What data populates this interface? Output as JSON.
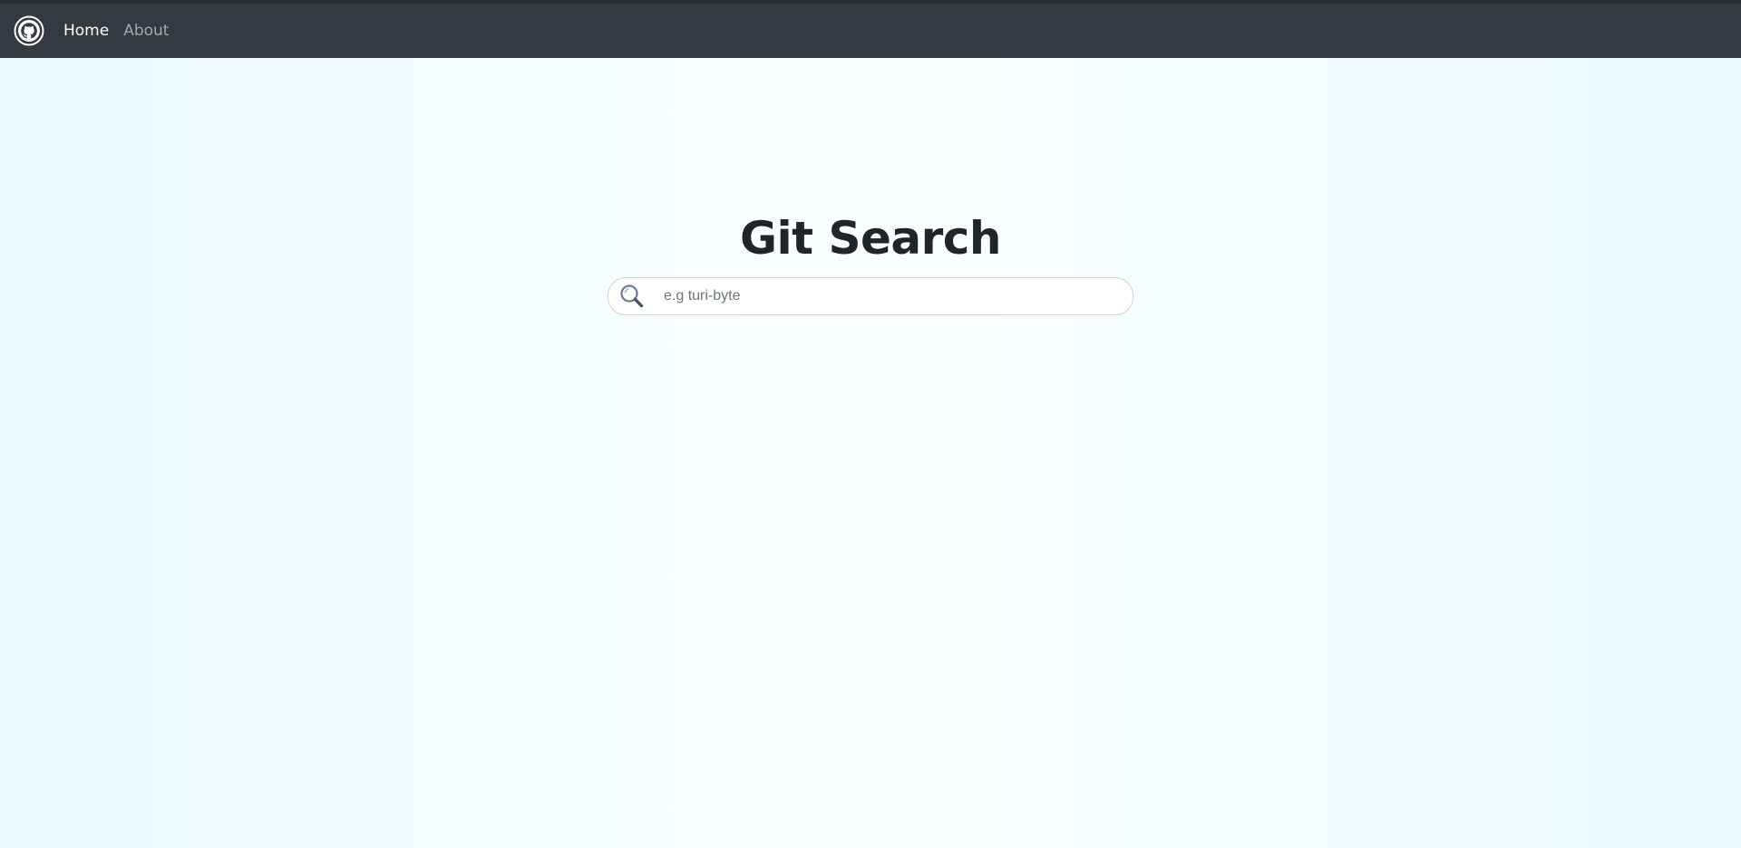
{
  "navbar": {
    "brand_icon": "github-icon",
    "links": [
      {
        "label": "Home",
        "active": true
      },
      {
        "label": "About",
        "active": false
      }
    ],
    "background": "#343a40"
  },
  "hero": {
    "title": "Git Search"
  },
  "search": {
    "icon": "search-icon",
    "placeholder": "e.g turi-byte",
    "value": ""
  },
  "colors": {
    "background_center": "#fbfeff",
    "background_edge": "#e9f9fe",
    "title": "#212529"
  }
}
